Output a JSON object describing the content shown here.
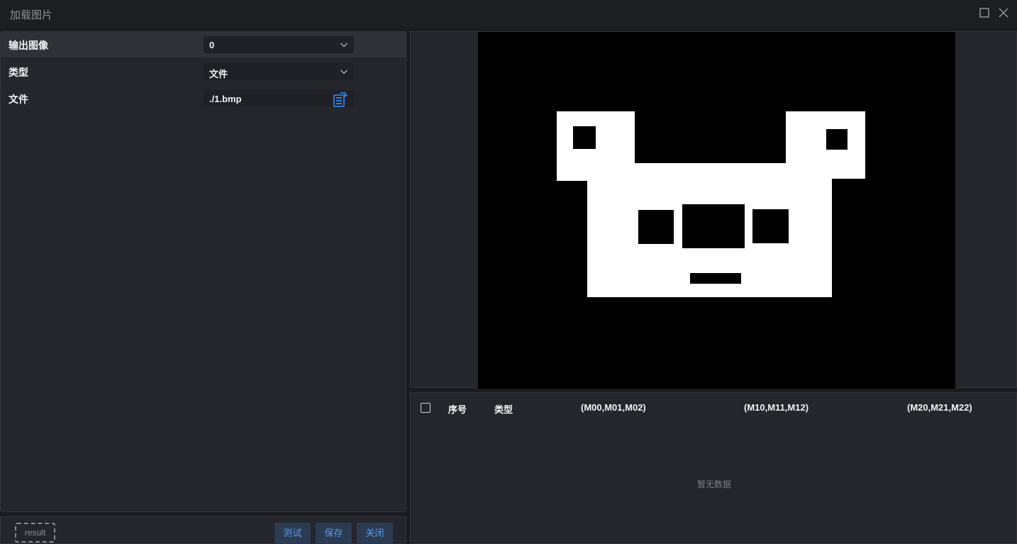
{
  "window": {
    "title": "加载图片"
  },
  "form": {
    "rows": [
      {
        "label": "输出图像",
        "value": "0",
        "control": "select"
      },
      {
        "label": "类型",
        "value": "文件",
        "control": "select"
      },
      {
        "label": "文件",
        "value": "./1.bmp",
        "control": "file"
      }
    ]
  },
  "footer": {
    "result_label": "result",
    "test_label": "测试",
    "save_label": "保存",
    "close_label": "关闭"
  },
  "table": {
    "columns": [
      "序号",
      "类型",
      "(M00,M01,M02)",
      "(M10,M11,M12)",
      "(M20,M21,M22)"
    ],
    "empty_text": "暂无数据"
  },
  "colors": {
    "accent": "#5b9be8",
    "button_bg": "#2b3b52",
    "file_icon": "#2f7fe0"
  }
}
